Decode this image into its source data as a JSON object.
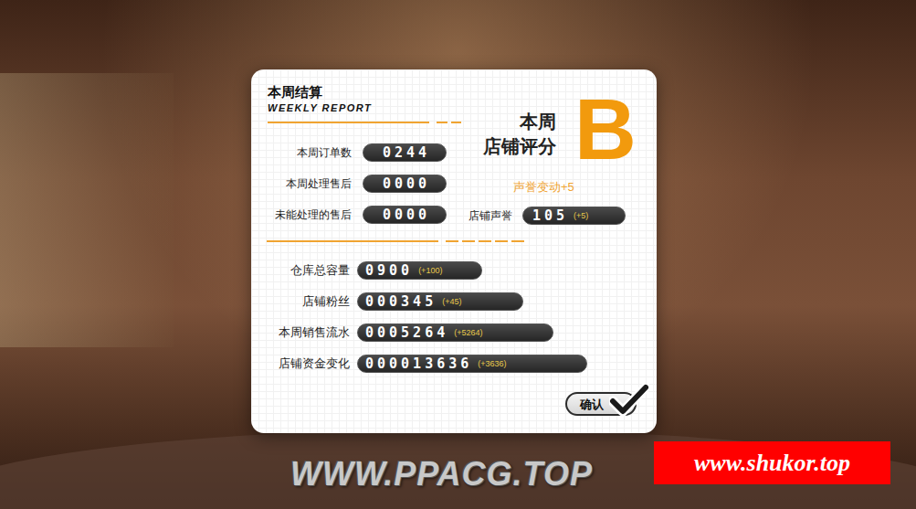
{
  "header": {
    "title": "本周结算",
    "subtitle": "WEEKLY REPORT"
  },
  "grade": {
    "label": [
      "本周",
      "店铺评分"
    ],
    "value": "B"
  },
  "stats": [
    {
      "label": "本周订单数",
      "value": "0244"
    },
    {
      "label": "本周处理售后",
      "value": "0000"
    },
    {
      "label": "未能处理的售后",
      "value": "0000"
    }
  ],
  "reputation": {
    "change": "声誉变动+5",
    "label": "店铺声誉",
    "value": "105",
    "delta": "(+5)"
  },
  "resources": [
    {
      "label": "仓库总容量",
      "value": "0900",
      "delta": "(+100)"
    },
    {
      "label": "店铺粉丝",
      "value": "000345",
      "delta": "(+45)"
    },
    {
      "label": "本周销售流水",
      "value": "0005264",
      "delta": "(+5264)"
    },
    {
      "label": "店铺资金变化",
      "value": "000013636",
      "delta": "(+3636)"
    }
  ],
  "confirm_button": {
    "label": "确认"
  },
  "watermarks": [
    "WWW.PPACG.TOP",
    "www.shukor.top"
  ]
}
